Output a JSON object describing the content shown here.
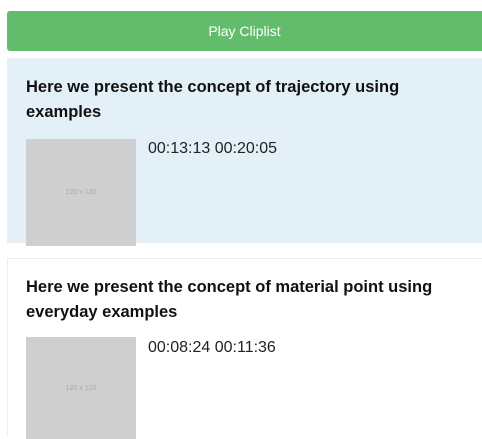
{
  "play_button": {
    "label": "Play Cliplist"
  },
  "clips": [
    {
      "title": "Here we present the concept of trajectory using examples",
      "thumbnail_text": "120 x 120",
      "start": "00:13:13",
      "end": "00:20:05"
    },
    {
      "title": "Here we present the concept of material point using everyday examples",
      "thumbnail_text": "120 x 120",
      "start": "00:08:24",
      "end": "00:11:36"
    }
  ],
  "colors": {
    "play_button_bg": "#63bc6b",
    "active_clip_bg": "#e3f0f7",
    "thumbnail_bg": "#cfcfcf"
  }
}
